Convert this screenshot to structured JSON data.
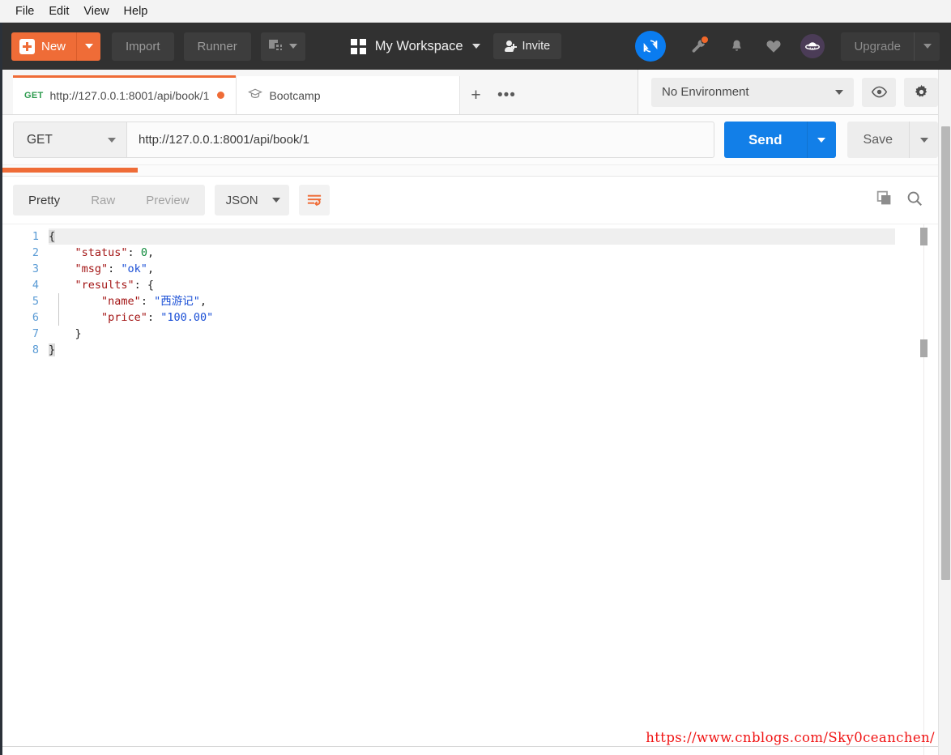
{
  "menubar": {
    "items": [
      {
        "label": "File"
      },
      {
        "label": "Edit"
      },
      {
        "label": "View"
      },
      {
        "label": "Help"
      }
    ]
  },
  "toolbar": {
    "new_label": "New",
    "new_icon": "plus-square-icon",
    "import_label": "Import",
    "runner_label": "Runner",
    "new_collection_icon": "new-collection-icon",
    "workspace_icon": "grid-icon",
    "workspace_label": "My Workspace",
    "invite_label": "Invite",
    "invite_icon": "person-add-icon",
    "sync_icon": "sync-icon",
    "wrench_icon": "wrench-icon",
    "bell_icon": "bell-icon",
    "heart_icon": "heart-icon",
    "avatar_icon": "ufo-avatar-icon",
    "upgrade_label": "Upgrade",
    "accent_orange": "#ef6c37",
    "accent_blue": "#0a7cf0",
    "bg_dark": "#313131"
  },
  "tabs": {
    "items": [
      {
        "method": "GET",
        "title": "http://127.0.0.1:8001/api/book/1",
        "unsaved": true,
        "active": true
      },
      {
        "icon": "graduation-cap-icon",
        "title": "Bootcamp",
        "active": false
      }
    ],
    "add_label": "+",
    "more_label": "•••"
  },
  "environment": {
    "selected": "No Environment",
    "eye_icon": "eye-icon",
    "gear_icon": "gear-icon"
  },
  "request": {
    "method": "GET",
    "url": "http://127.0.0.1:8001/api/book/1",
    "send_label": "Send",
    "save_label": "Save"
  },
  "response": {
    "view_tabs": [
      {
        "label": "Pretty",
        "active": true
      },
      {
        "label": "Raw",
        "active": false
      },
      {
        "label": "Preview",
        "active": false
      }
    ],
    "format": "JSON",
    "wrap_icon": "word-wrap-icon",
    "copy_icon": "copy-icon",
    "search_icon": "search-icon",
    "body_lines": [
      {
        "num": "1",
        "tokens": [
          {
            "t": "{",
            "c": "pun"
          }
        ]
      },
      {
        "num": "2",
        "tokens": [
          {
            "t": "    ",
            "c": "pun"
          },
          {
            "t": "\"status\"",
            "c": "key"
          },
          {
            "t": ": ",
            "c": "pun"
          },
          {
            "t": "0",
            "c": "num"
          },
          {
            "t": ",",
            "c": "pun"
          }
        ]
      },
      {
        "num": "3",
        "tokens": [
          {
            "t": "    ",
            "c": "pun"
          },
          {
            "t": "\"msg\"",
            "c": "key"
          },
          {
            "t": ": ",
            "c": "pun"
          },
          {
            "t": "\"ok\"",
            "c": "str"
          },
          {
            "t": ",",
            "c": "pun"
          }
        ]
      },
      {
        "num": "4",
        "tokens": [
          {
            "t": "    ",
            "c": "pun"
          },
          {
            "t": "\"results\"",
            "c": "key"
          },
          {
            "t": ": {",
            "c": "pun"
          }
        ]
      },
      {
        "num": "5",
        "tokens": [
          {
            "t": "        ",
            "c": "pun"
          },
          {
            "t": "\"name\"",
            "c": "key"
          },
          {
            "t": ": ",
            "c": "pun"
          },
          {
            "t": "\"西游记\"",
            "c": "str"
          },
          {
            "t": ",",
            "c": "pun"
          }
        ]
      },
      {
        "num": "6",
        "tokens": [
          {
            "t": "        ",
            "c": "pun"
          },
          {
            "t": "\"price\"",
            "c": "key"
          },
          {
            "t": ": ",
            "c": "pun"
          },
          {
            "t": "\"100.00\"",
            "c": "str"
          }
        ]
      },
      {
        "num": "7",
        "tokens": [
          {
            "t": "    }",
            "c": "pun"
          }
        ]
      },
      {
        "num": "8",
        "tokens": [
          {
            "t": "}",
            "c": "pun"
          }
        ]
      }
    ],
    "json_payload": {
      "status": 0,
      "msg": "ok",
      "results": {
        "name": "西游记",
        "price": "100.00"
      }
    }
  },
  "watermark": {
    "text": "https://www.cnblogs.com/Sky0ceanchen/",
    "color": "#f01414"
  }
}
